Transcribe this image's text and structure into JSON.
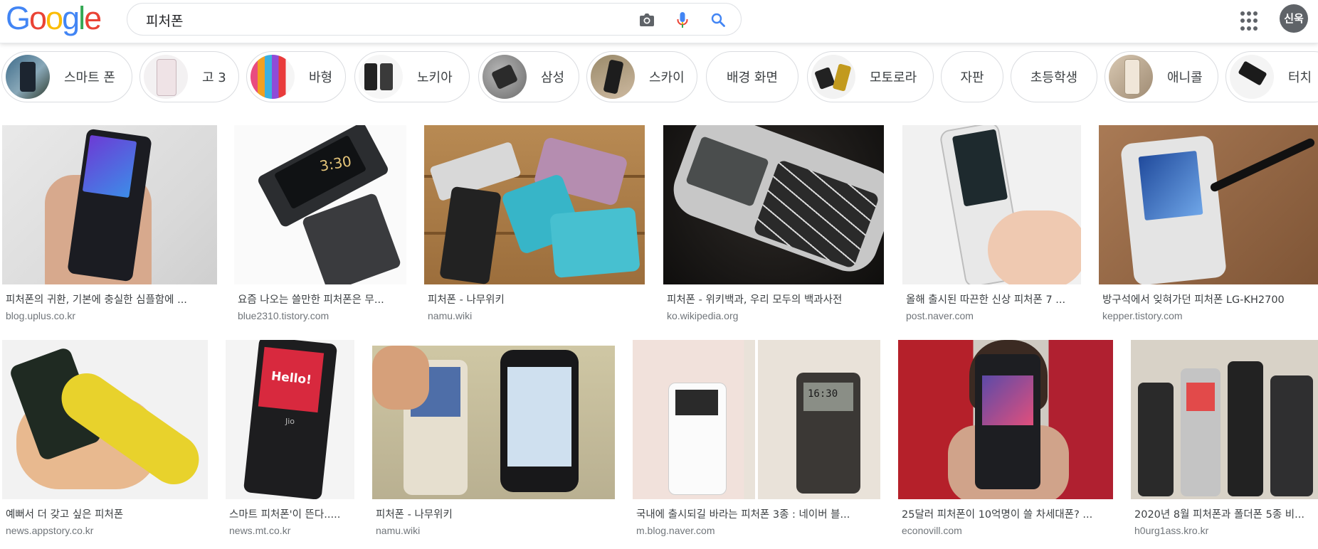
{
  "search": {
    "query": "피처폰"
  },
  "header": {
    "logo_letters": [
      "G",
      "o",
      "o",
      "g",
      "l",
      "e"
    ],
    "logo_colors": [
      "#4285F4",
      "#EA4335",
      "#FBBC05",
      "#4285F4",
      "#34A853",
      "#EA4335"
    ],
    "avatar_text": "신욱",
    "icons": [
      "camera-icon",
      "microphone-icon",
      "search-icon",
      "apps-icon"
    ]
  },
  "chips": [
    {
      "label": "스마트 폰"
    },
    {
      "label": "고 3"
    },
    {
      "label": "바형"
    },
    {
      "label": "노키아"
    },
    {
      "label": "삼성"
    },
    {
      "label": "스카이"
    },
    {
      "label": "배경 화면"
    },
    {
      "label": "모토로라"
    },
    {
      "label": "자판"
    },
    {
      "label": "초등학생"
    },
    {
      "label": "애니콜"
    },
    {
      "label": "터치"
    }
  ],
  "results": [
    {
      "title": "피처폰의 귀환, 기본에 충실한 심플함에 ...",
      "source": "blog.uplus.co.kr"
    },
    {
      "title": "요즘 나오는 쓸만한 피처폰은 무...",
      "source": "blue2310.tistory.com"
    },
    {
      "title": "피처폰 - 나무위키",
      "source": "namu.wiki"
    },
    {
      "title": "피처폰 - 위키백과, 우리 모두의 백과사전",
      "source": "ko.wikipedia.org"
    },
    {
      "title": "올해 출시된 따끈한 신상 피처폰 7 ...",
      "source": "post.naver.com"
    },
    {
      "title": "방구석에서 잊혀가던 피처폰 LG-KH2700",
      "source": "kepper.tistory.com"
    },
    {
      "title": "예뻐서 더 갖고 싶은 피처폰",
      "source": "news.appstory.co.kr"
    },
    {
      "title": "스마트 피처폰'이 뜬다.....",
      "source": "news.mt.co.kr"
    },
    {
      "title": "피처폰 - 나무위키",
      "source": "namu.wiki"
    },
    {
      "title": "국내에 출시되길 바라는 피처폰 3종 : 네이버 블...",
      "source": "m.blog.naver.com"
    },
    {
      "title": "25달러 피처폰이 10억명이 쓸 차세대폰? ...",
      "source": "econovill.com"
    },
    {
      "title": "2020년 8월 피처폰과 폴더폰 5종 비...",
      "source": "h0urg1ass.kro.kr"
    }
  ],
  "image_texts": {
    "jio_hello": "Hello!",
    "phone_clock": "3:30",
    "phone_clock_2": "16:30",
    "brand_jio": "Jio"
  },
  "colors": {
    "chip_border": "#dadce0",
    "source_gray": "#70757a",
    "title_gray": "#3c4043"
  }
}
